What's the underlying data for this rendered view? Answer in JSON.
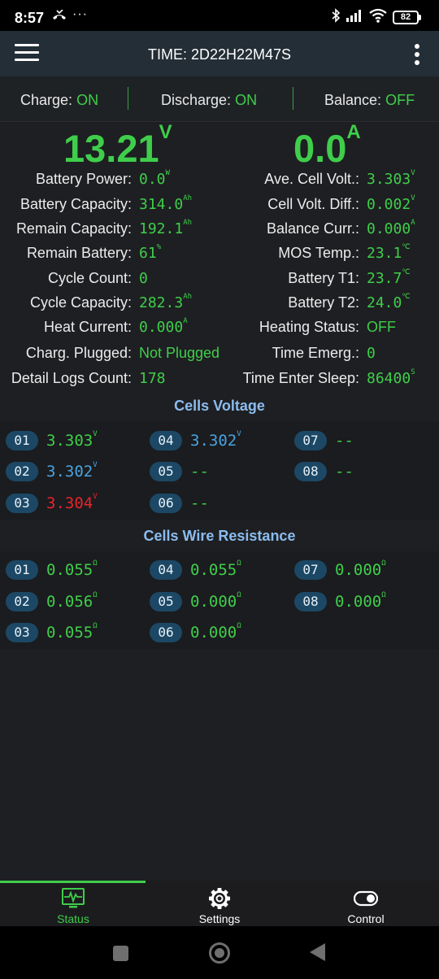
{
  "status_bar": {
    "time": "8:57",
    "call_icon": "missed-call-icon",
    "more": "···",
    "battery": "82"
  },
  "app_bar": {
    "title": "TIME: 2D22H22M47S"
  },
  "modes": {
    "charge_label": "Charge:",
    "charge_value": "ON",
    "discharge_label": "Discharge:",
    "discharge_value": "ON",
    "balance_label": "Balance:",
    "balance_value": "OFF"
  },
  "readings": {
    "voltage": "13.21",
    "voltage_unit": "V",
    "current": "0.0",
    "current_unit": "A"
  },
  "left_info": [
    {
      "label": "Battery Power:",
      "value": "0.0",
      "unit": "W"
    },
    {
      "label": "Battery Capacity:",
      "value": "314.0",
      "unit": "Ah"
    },
    {
      "label": "Remain Capacity:",
      "value": "192.1",
      "unit": "Ah"
    },
    {
      "label": "Remain Battery:",
      "value": "61",
      "unit": "%"
    },
    {
      "label": "Cycle Count:",
      "value": "0",
      "unit": ""
    },
    {
      "label": "Cycle Capacity:",
      "value": "282.3",
      "unit": "Ah"
    },
    {
      "label": "Heat Current:",
      "value": "0.000",
      "unit": "A"
    },
    {
      "label": "Charg. Plugged:",
      "value": "Not Plugged",
      "unit": ""
    },
    {
      "label": "Detail Logs Count:",
      "value": "178",
      "unit": ""
    }
  ],
  "right_info": [
    {
      "label": "Ave. Cell Volt.:",
      "value": "3.303",
      "unit": "V"
    },
    {
      "label": "Cell Volt. Diff.:",
      "value": "0.002",
      "unit": "V"
    },
    {
      "label": "Balance Curr.:",
      "value": "0.000",
      "unit": "A"
    },
    {
      "label": "MOS Temp.:",
      "value": "23.1",
      "unit": "℃"
    },
    {
      "label": "Battery T1:",
      "value": "23.7",
      "unit": "℃"
    },
    {
      "label": "Battery T2:",
      "value": "24.0",
      "unit": "℃"
    },
    {
      "label": "Heating Status:",
      "value": "OFF",
      "unit": ""
    },
    {
      "label": "Time Emerg.:",
      "value": "0",
      "unit": ""
    },
    {
      "label": "Time Enter Sleep:",
      "value": "86400",
      "unit": "S"
    }
  ],
  "cells_voltage": {
    "title": "Cells Voltage",
    "cells": [
      {
        "id": "01",
        "value": "3.303",
        "unit": "V"
      },
      {
        "id": "02",
        "value": "3.302",
        "unit": "V"
      },
      {
        "id": "03",
        "value": "3.304",
        "unit": "V"
      },
      {
        "id": "04",
        "value": "3.302",
        "unit": "V"
      },
      {
        "id": "05",
        "value": "--",
        "unit": ""
      },
      {
        "id": "06",
        "value": "--",
        "unit": ""
      },
      {
        "id": "07",
        "value": "--",
        "unit": ""
      },
      {
        "id": "08",
        "value": "--",
        "unit": ""
      }
    ]
  },
  "cells_resistance": {
    "title": "Cells Wire Resistance",
    "cells": [
      {
        "id": "01",
        "value": "0.055",
        "unit": "Ω"
      },
      {
        "id": "02",
        "value": "0.056",
        "unit": "Ω"
      },
      {
        "id": "03",
        "value": "0.055",
        "unit": "Ω"
      },
      {
        "id": "04",
        "value": "0.055",
        "unit": "Ω"
      },
      {
        "id": "05",
        "value": "0.000",
        "unit": "Ω"
      },
      {
        "id": "06",
        "value": "0.000",
        "unit": "Ω"
      },
      {
        "id": "07",
        "value": "0.000",
        "unit": "Ω"
      },
      {
        "id": "08",
        "value": "0.000",
        "unit": "Ω"
      }
    ]
  },
  "bottom_nav": [
    {
      "label": "Status",
      "icon": "monitor-pulse-icon",
      "active": true
    },
    {
      "label": "Settings",
      "icon": "gear-icon",
      "active": false
    },
    {
      "label": "Control",
      "icon": "toggle-icon",
      "active": false
    }
  ],
  "colors": {
    "accent_green": "#3fce4b",
    "section_blue": "#8bbcef",
    "min_cell_blue": "#4aa3df",
    "max_cell_red": "#e8242a",
    "badge_bg": "#1c4866"
  }
}
